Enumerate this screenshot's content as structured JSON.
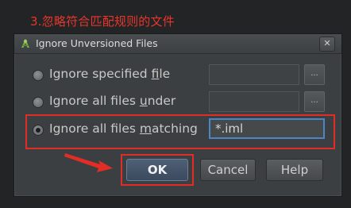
{
  "annotation": {
    "caption": "3.忽略符合匹配规则的文件"
  },
  "dialog": {
    "title": "Ignore Unversioned Files",
    "close_glyph": "✕",
    "options": [
      {
        "pre": "Ignore specified ",
        "mnemonic": "f",
        "post": "ile",
        "checked": false,
        "field_value": "",
        "browse": "..."
      },
      {
        "pre": "Ignore all files ",
        "mnemonic": "u",
        "post": "nder",
        "checked": false,
        "field_value": "",
        "browse": "..."
      },
      {
        "pre": "Ignore all files ",
        "mnemonic": "m",
        "post": "atching",
        "checked": true,
        "field_value": "*.iml"
      }
    ],
    "buttons": {
      "ok": "OK",
      "cancel": "Cancel",
      "help": "Help"
    }
  },
  "colors": {
    "highlight": "#e12d26",
    "focus": "#4a87c7",
    "dialog_bg": "#3c3f41"
  },
  "icons": {
    "title": "android-studio-icon",
    "arrow": "red-pointer-arrow"
  }
}
